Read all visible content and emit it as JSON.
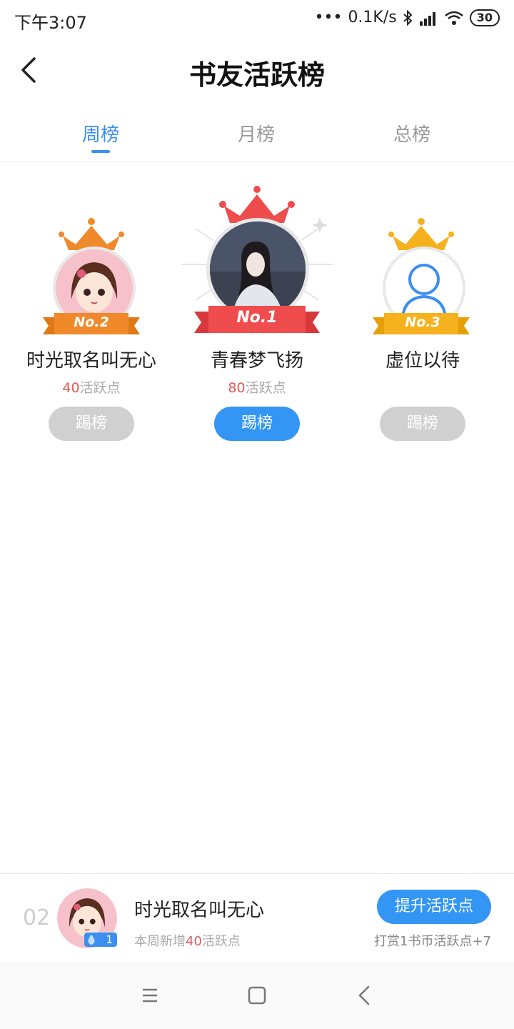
{
  "status_bar": {
    "time": "下午3:07",
    "network_speed": "0.1K/s",
    "battery": "30"
  },
  "header": {
    "title": "书友活跃榜"
  },
  "tabs": [
    {
      "label": "周榜",
      "active": true
    },
    {
      "label": "月榜",
      "active": false
    },
    {
      "label": "总榜",
      "active": false
    }
  ],
  "podium": {
    "first": {
      "rank_label": "No.1",
      "name": "青春梦飞扬",
      "points": "80",
      "points_unit": "活跃点",
      "button": "踢榜"
    },
    "second": {
      "rank_label": "No.2",
      "name": "时光取名叫无心",
      "points": "40",
      "points_unit": "活跃点",
      "button": "踢榜"
    },
    "third": {
      "rank_label": "No.3",
      "name": "虚位以待",
      "button": "踢榜"
    }
  },
  "my_rank": {
    "rank": "02",
    "level": "1",
    "name": "时光取名叫无心",
    "sub_prefix": "本周新增",
    "sub_points": "40",
    "sub_suffix": "活跃点",
    "boost_button": "提升活跃点",
    "boost_note": "打赏1书币活跃点+7"
  },
  "colors": {
    "accent": "#3396f4",
    "points": "#e25a5a",
    "gold": "#f5a623",
    "red": "#ef4d4d",
    "orange": "#f0892a"
  }
}
